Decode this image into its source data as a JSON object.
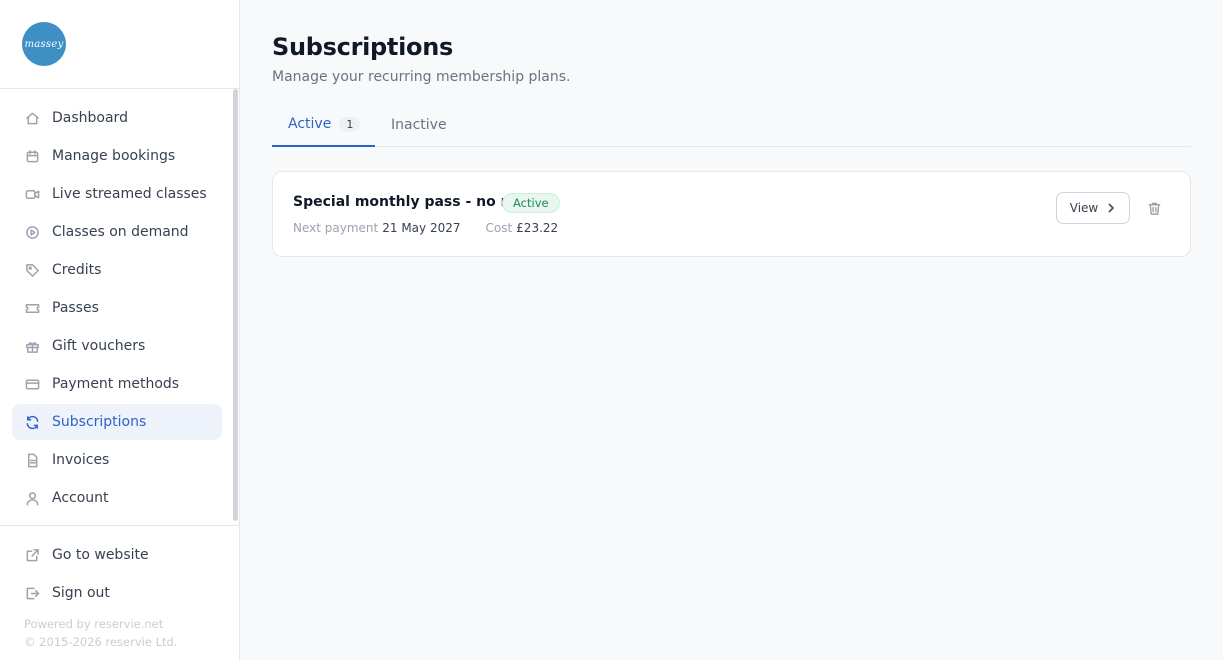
{
  "app": {
    "logo_text": "massey"
  },
  "sidebar": {
    "items": [
      {
        "label": "Dashboard",
        "icon": "home-icon"
      },
      {
        "label": "Manage bookings",
        "icon": "calendar-icon"
      },
      {
        "label": "Live streamed classes",
        "icon": "video-icon"
      },
      {
        "label": "Classes on demand",
        "icon": "play-circle-icon"
      },
      {
        "label": "Credits",
        "icon": "tag-icon"
      },
      {
        "label": "Passes",
        "icon": "ticket-icon"
      },
      {
        "label": "Gift vouchers",
        "icon": "gift-icon"
      },
      {
        "label": "Payment methods",
        "icon": "credit-card-icon"
      },
      {
        "label": "Subscriptions",
        "icon": "refresh-icon",
        "active": true
      },
      {
        "label": "Invoices",
        "icon": "document-icon"
      },
      {
        "label": "Account",
        "icon": "user-icon"
      }
    ],
    "bottom_items": [
      {
        "label": "Go to website",
        "icon": "external-link-icon"
      },
      {
        "label": "Sign out",
        "icon": "sign-out-icon"
      }
    ],
    "footer": {
      "powered_by": "Powered by reservie.net",
      "copyright": "© 2015-2026 reservie Ltd."
    }
  },
  "page": {
    "title": "Subscriptions",
    "subtitle": "Manage your recurring membership plans."
  },
  "tabs": {
    "active_label": "Active",
    "active_count": "1",
    "inactive_label": "Inactive"
  },
  "subscriptions": [
    {
      "name": "Special monthly pass - no min",
      "status": "Active",
      "next_payment_label": "Next payment",
      "next_payment_value": "21 May 2027",
      "cost_label": "Cost",
      "cost_value": "£23.22",
      "view_label": "View"
    }
  ],
  "colors": {
    "accent": "#2f62c9",
    "active_nav_bg": "#eef2fb",
    "status_active_bg": "#e7f6ee",
    "status_active_text": "#1f8a5b",
    "logo_bg": "#3d8fc4"
  }
}
